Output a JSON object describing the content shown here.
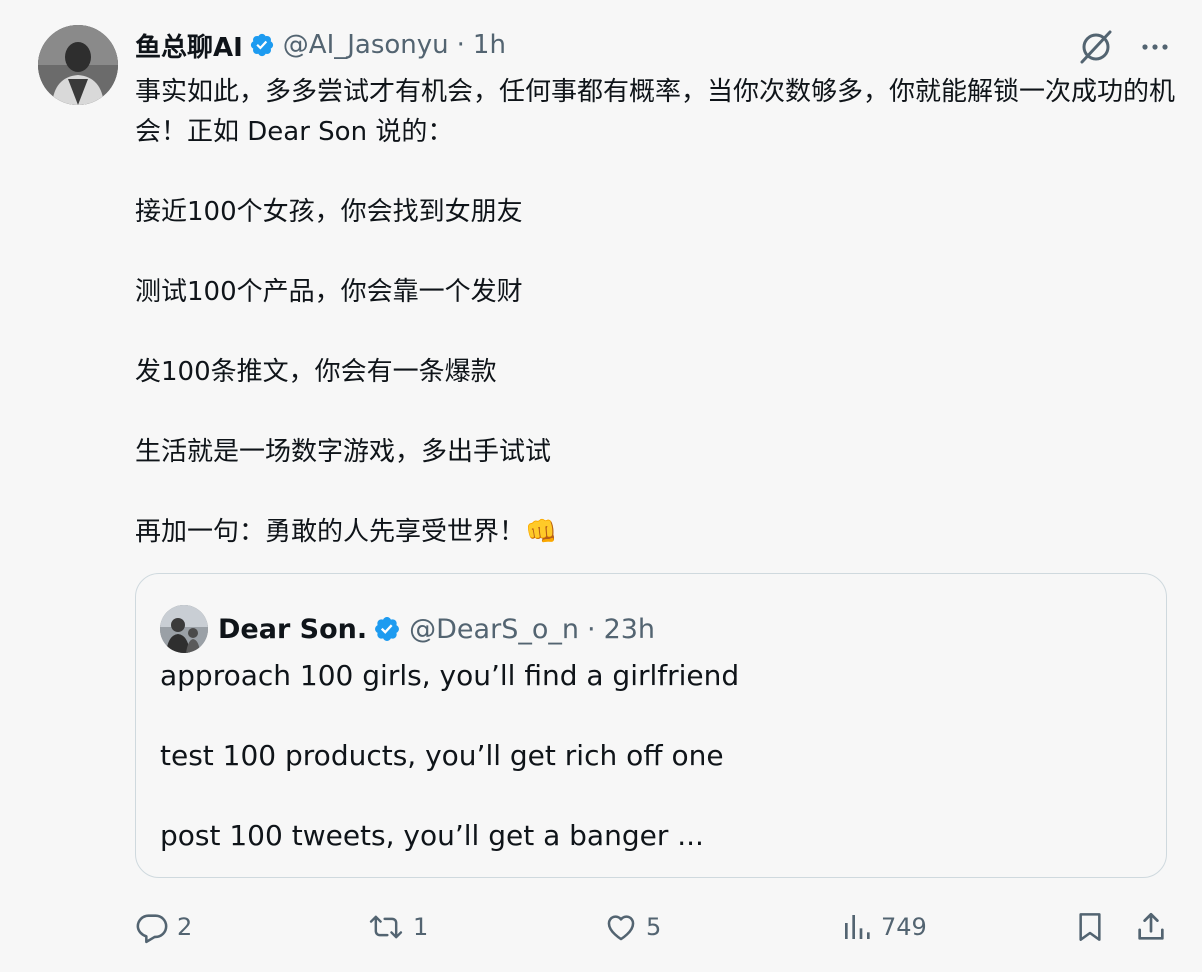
{
  "tweet": {
    "author_name": "鱼总聊AI",
    "handle": "@AI_Jasonyu",
    "separator": "·",
    "time": "1h",
    "text": "事实如此，多多尝试才有机会，任何事都有概率，当你次数够多，你就能解锁一次成功的机会！正如 Dear Son 说的：\n\n接近100个女孩，你会找到女朋友\n\n测试100个产品，你会靠一个发财\n\n发100条推文，你会有一条爆款\n\n生活就是一场数字游戏，多出手试试\n\n再加一句：勇敢的人先享受世界！👊"
  },
  "quoted_tweet": {
    "author_name": "Dear Son.",
    "handle": "@DearS_o_n",
    "separator": "·",
    "time": "23h",
    "text": "approach 100 girls, you’ll find a girlfriend\n\ntest 100 products, you’ll get rich off one\n\npost 100 tweets, you’ll get a banger ..."
  },
  "actions": {
    "replies": "2",
    "retweets": "1",
    "likes": "5",
    "views": "749"
  },
  "icons": {
    "verified": "verified-badge-icon",
    "grok": "grok-icon",
    "more": "more-icon",
    "reply": "reply-icon",
    "retweet": "retweet-icon",
    "like": "heart-icon",
    "views": "views-icon",
    "bookmark": "bookmark-icon",
    "share": "share-icon"
  },
  "colors": {
    "verified": "#1d9bf0",
    "muted": "#536471",
    "text": "#0f1419",
    "border": "#cfd9de",
    "background": "#f7f7f7"
  }
}
